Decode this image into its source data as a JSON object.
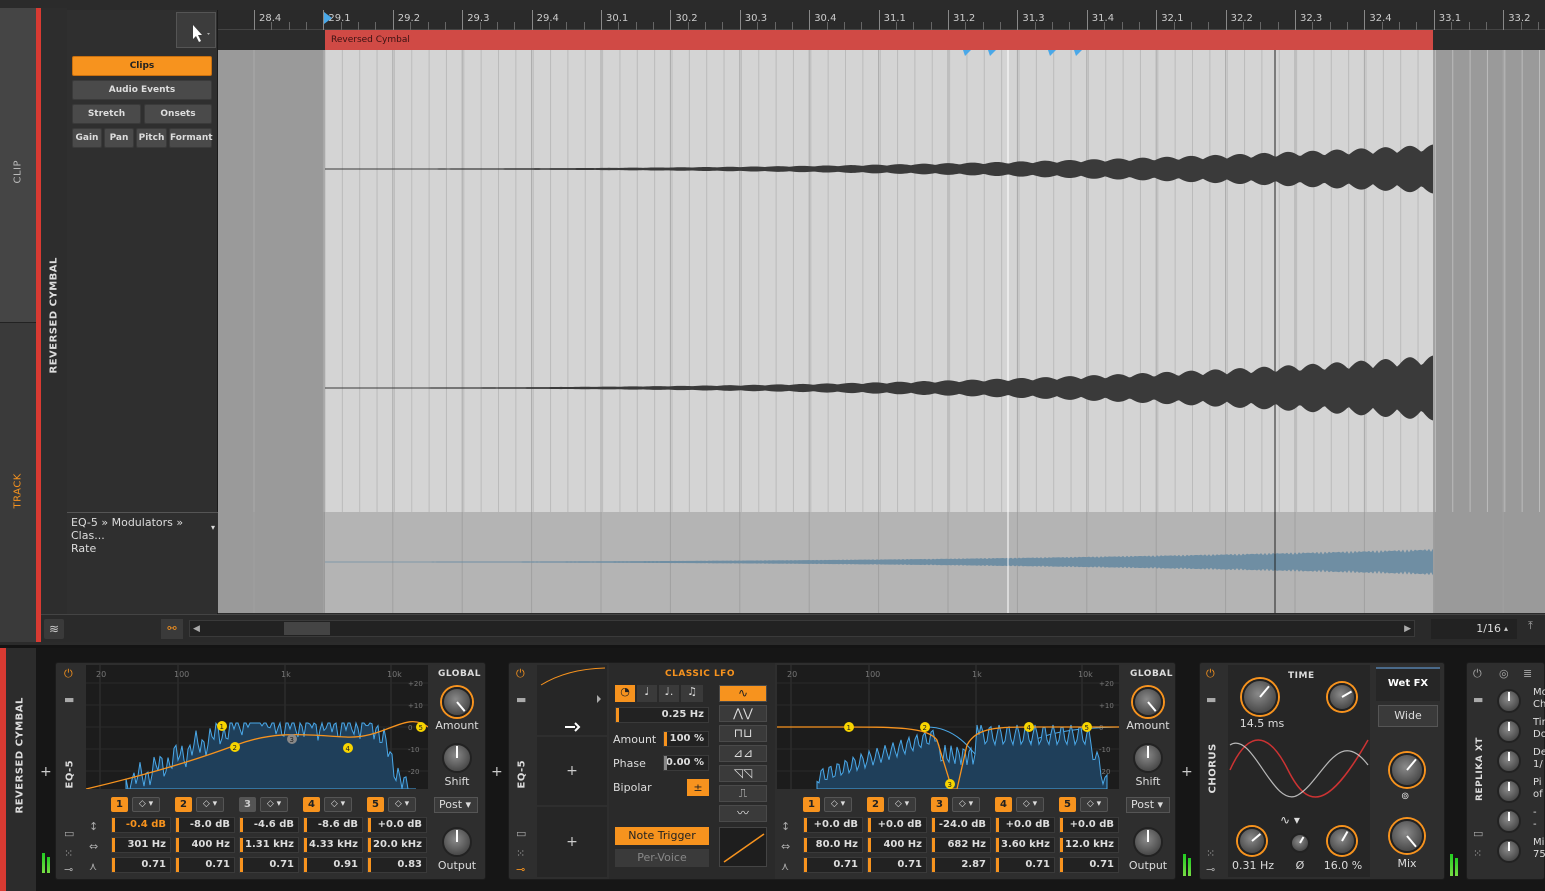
{
  "side_tabs": {
    "clip": "CLIP",
    "track": "TRACK"
  },
  "track_name": "REVERSED CYMBAL",
  "inspector": {
    "clips": "Clips",
    "audio_events": "Audio Events",
    "stretch": "Stretch",
    "onsets": "Onsets",
    "gain": "Gain",
    "pan": "Pan",
    "pitch": "Pitch",
    "formant": "Formant"
  },
  "ruler": [
    "28.4",
    "29.1",
    "29.2",
    "29.3",
    "29.4",
    "30.1",
    "30.2",
    "30.3",
    "30.4",
    "31.1",
    "31.2",
    "31.3",
    "31.4",
    "32.1",
    "32.2",
    "32.3",
    "32.4",
    "33.1",
    "33.2"
  ],
  "clip_name": "Reversed Cymbal",
  "automation": {
    "path": "EQ-5 » Modulators » Clas...",
    "param": "Rate"
  },
  "grid": "1/16",
  "devices": {
    "track_name": "REVERSED CYMBAL",
    "eq1": {
      "name": "EQ-5",
      "freq_labels": [
        "20",
        "100",
        "1k",
        "10k"
      ],
      "db_labels": [
        "+20",
        "+10",
        "0",
        "-10",
        "-20"
      ],
      "bands": [
        "1",
        "2",
        "3",
        "4",
        "5"
      ],
      "gains": [
        "-0.4 dB",
        "-8.0 dB",
        "-4.6 dB",
        "-8.6 dB",
        "+0.0 dB"
      ],
      "freqs": [
        "301 Hz",
        "400 Hz",
        "1.31 kHz",
        "4.33 kHz",
        "20.0 kHz"
      ],
      "qs": [
        "0.71",
        "0.71",
        "0.71",
        "0.91",
        "0.83"
      ],
      "global": "GLOBAL",
      "amount": "Amount",
      "shift": "Shift",
      "post": "Post",
      "output": "Output"
    },
    "lfo": {
      "title": "CLASSIC LFO",
      "rate": "0.25 Hz",
      "amount_label": "Amount",
      "amount": "100 %",
      "phase_label": "Phase",
      "phase": "0.00 %",
      "bipolar": "Bipolar",
      "bipolar_btn": "±",
      "note_trigger": "Note Trigger",
      "per_voice": "Per-Voice"
    },
    "eq2": {
      "name": "EQ-5",
      "freq_labels": [
        "20",
        "100",
        "1k",
        "10k"
      ],
      "db_labels": [
        "+20",
        "+10",
        "0",
        "-10",
        "-20"
      ],
      "bands": [
        "1",
        "2",
        "3",
        "4",
        "5"
      ],
      "gains": [
        "+0.0 dB",
        "+0.0 dB",
        "-24.0 dB",
        "+0.0 dB",
        "+0.0 dB"
      ],
      "freqs": [
        "80.0 Hz",
        "400 Hz",
        "682 Hz",
        "3.60 kHz",
        "12.0 kHz"
      ],
      "qs": [
        "0.71",
        "0.71",
        "2.87",
        "0.71",
        "0.71"
      ],
      "global": "GLOBAL",
      "amount": "Amount",
      "shift": "Shift",
      "post": "Post",
      "output": "Output"
    },
    "chorus": {
      "name": "CHORUS",
      "time_label": "TIME",
      "time": "14.5 ms",
      "rate": "0.31 Hz",
      "phase_sym": "Ø",
      "depth": "16.0 %",
      "wet_fx": "Wet FX",
      "wide": "Wide",
      "mix": "Mix"
    },
    "replika": {
      "name": "REPLIKA XT",
      "labels": [
        "Mo",
        "Ch",
        "Tir",
        "Do",
        "De",
        "1/",
        "Pi",
        "of",
        "-",
        "-",
        "Mi",
        "75"
      ]
    }
  },
  "colors": {
    "accent": "#f7931e",
    "clip": "#d04a45",
    "track_red": "#d83a32",
    "spectrum": "#4aa8e8"
  }
}
